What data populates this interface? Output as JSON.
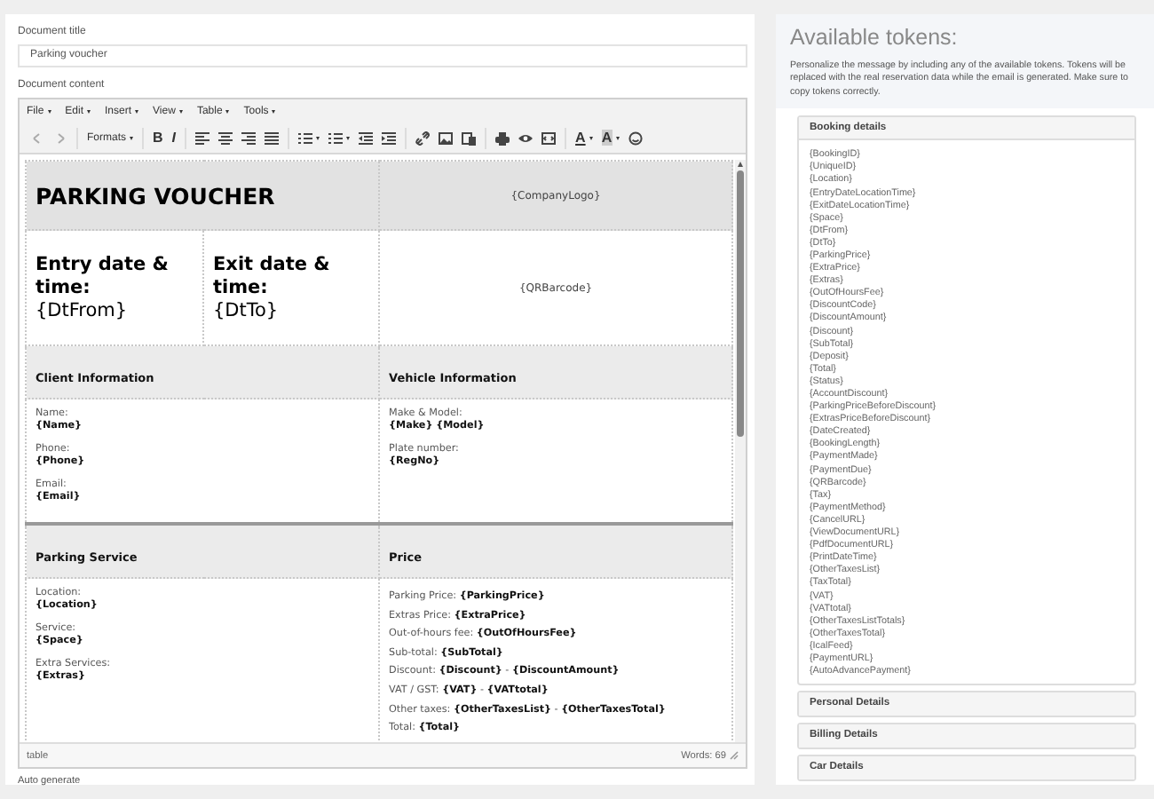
{
  "title_field": {
    "label": "Document title",
    "value": "Parking voucher"
  },
  "content_label": "Document content",
  "editor": {
    "menus": [
      "File",
      "Edit",
      "Insert",
      "View",
      "Table",
      "Tools"
    ],
    "toolbar": {
      "formats": "Formats",
      "bold": "B",
      "italic": "I",
      "text_color": "A",
      "background_color": "A"
    },
    "voucher": {
      "title": "PARKING VOUCHER",
      "logo_token": "{CompanyLogo}",
      "entry_label": "Entry date & time:",
      "entry_token": "{DtFrom}",
      "exit_label": "Exit date & time:",
      "exit_token": "{DtTo}",
      "qr_token": "{QRBarcode}",
      "sections": [
        {
          "left": {
            "heading": "Client Information",
            "fields": [
              {
                "kind": "stacked",
                "label": "Name:",
                "value": "{Name}"
              },
              {
                "kind": "stacked",
                "label": "Phone:",
                "value": "{Phone}"
              },
              {
                "kind": "stacked",
                "label": "Email:",
                "value": "{Email}"
              }
            ]
          },
          "right": {
            "heading": "Vehicle Information",
            "fields": [
              {
                "kind": "stacked",
                "label": "Make & Model:",
                "value": "{Make} {Model}"
              },
              {
                "kind": "stacked",
                "label": "Plate number:",
                "value": "{RegNo}"
              }
            ]
          }
        },
        {
          "left": {
            "heading": "Parking Service",
            "fields": [
              {
                "kind": "stacked",
                "label": "Location:",
                "value": "{Location}"
              },
              {
                "kind": "stacked",
                "label": "Service:",
                "value": "{Space}"
              },
              {
                "kind": "stacked",
                "label": "Extra Services:",
                "value": "{Extras}"
              }
            ]
          },
          "right": {
            "heading": "Price",
            "fields": [
              {
                "kind": "inline",
                "text": "Parking Price: **{ParkingPrice}**"
              },
              {
                "kind": "inline",
                "text": "Extras Price: **{ExtraPrice}**"
              },
              {
                "kind": "inline",
                "text": "Out-of-hours fee: **{OutOfHoursFee}**"
              },
              {
                "kind": "inline",
                "text": "Sub-total: **{SubTotal}**"
              },
              {
                "kind": "inline",
                "text": "Discount: **{Discount}** - **{DiscountAmount}**"
              },
              {
                "kind": "inline",
                "text": "VAT / GST: **{VAT}** - **{VATtotal}**"
              },
              {
                "kind": "inline",
                "text": "Other taxes: **{OtherTaxesList}** - **{OtherTaxesTotal}**"
              },
              {
                "kind": "inline",
                "text": "Total: **{Total}**"
              }
            ]
          }
        }
      ]
    },
    "status_path": "table",
    "word_count": "Words: 69"
  },
  "auto_generate_label": "Auto generate",
  "tokens_panel": {
    "title": "Available tokens:",
    "description": "Personalize the message by including any of the available tokens. Tokens will be replaced with the real reservation data while the email is generated. Make sure to copy tokens correctly.",
    "groups": [
      {
        "heading": "Booking details",
        "expanded": true,
        "tokens": [
          "{BookingID}",
          "{UniqueID}",
          "{Location}",
          "{EntryDateLocationTime}",
          "{ExitDateLocationTime}",
          "{Space}",
          "{DtFrom}",
          "{DtTo}",
          "{ParkingPrice}",
          "{ExtraPrice}",
          "{Extras}",
          "{OutOfHoursFee}",
          "{DiscountCode}",
          "{DiscountAmount}",
          "{Discount}",
          "{SubTotal}",
          "{Deposit}",
          "{Total}",
          "{Status}",
          "{AccountDiscount}",
          "{ParkingPriceBeforeDiscount}",
          "{ExtrasPriceBeforeDiscount}",
          "{DateCreated}",
          "{BookingLength}",
          "{PaymentMade}",
          "{PaymentDue}",
          "{QRBarcode}",
          "{Tax}",
          "{PaymentMethod}",
          "{CancelURL}",
          "{ViewDocumentURL}",
          "{PdfDocumentURL}",
          "{PrintDateTime}",
          "{OtherTaxesList}",
          "{TaxTotal}",
          "{VAT}",
          "{VATtotal}",
          "{OtherTaxesListTotals}",
          "{OtherTaxesTotal}",
          "{IcalFeed}",
          "{PaymentURL}",
          "{AutoAdvancePayment}"
        ]
      },
      {
        "heading": "Personal Details",
        "expanded": false
      },
      {
        "heading": "Billing Details",
        "expanded": false
      },
      {
        "heading": "Car Details",
        "expanded": false
      }
    ]
  }
}
